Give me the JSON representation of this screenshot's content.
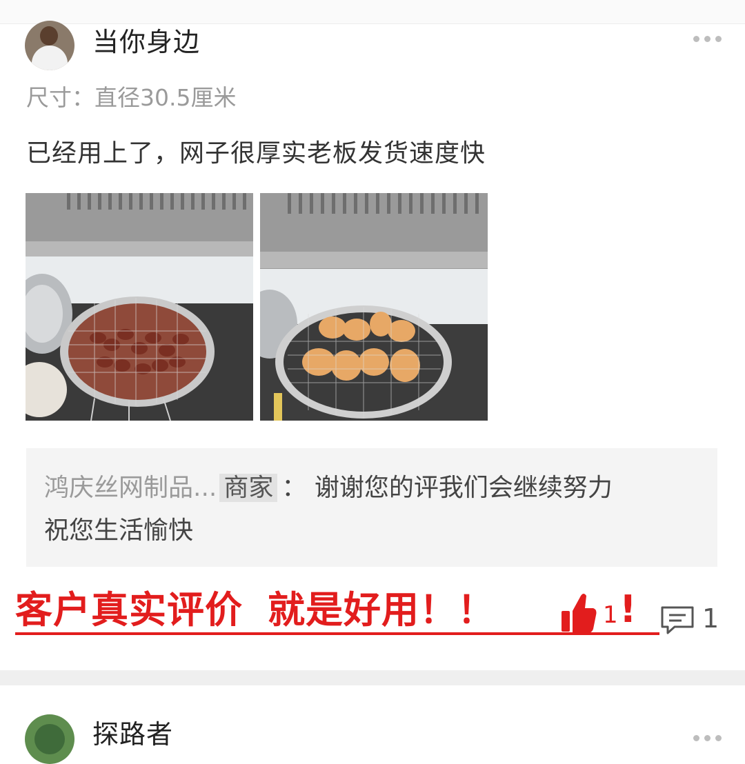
{
  "review1": {
    "username": "当你身边",
    "spec": "尺寸：直径30.5厘米",
    "text": "已经用上了，网子很厚实老板发货速度快",
    "photos": [
      "photo-skewers-grill",
      "photo-chicken-wings-grill"
    ],
    "merchant_reply": {
      "shop_name": "鸿庆丝网制品...",
      "tag": "商家",
      "separator": "：",
      "text_line1": "谢谢您的评我们会继续努力",
      "text_line2": "祝您生活愉快"
    },
    "promo_text": "客户真实评价",
    "promo_text2": "就是好用！！",
    "like_count": "1",
    "promo_end": "!",
    "comment_count": "1"
  },
  "review2": {
    "username": "探路者"
  },
  "colors": {
    "promo_red": "#e21d1d",
    "reply_bg": "#f4f4f4",
    "muted_text": "#9a9a9a"
  },
  "icons": [
    "more-dots-icon",
    "thumbs-up-icon",
    "comment-icon"
  ]
}
